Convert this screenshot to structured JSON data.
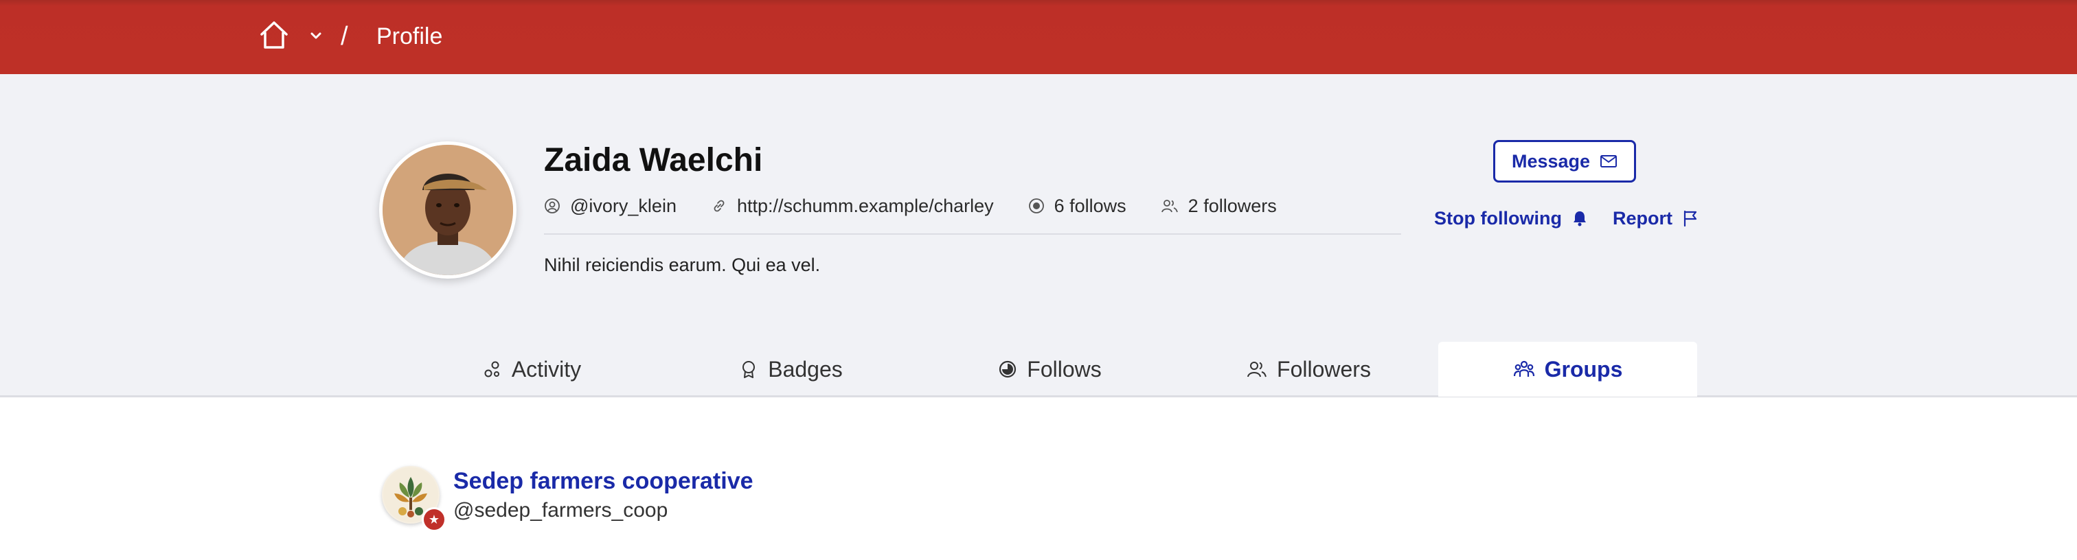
{
  "colors": {
    "brand_red": "#be3027",
    "link_blue": "#1a2aa8",
    "header_bg": "#f1f2f6"
  },
  "topbar": {
    "home_icon": "home-icon",
    "dropdown_icon": "chevron-down-icon",
    "separator": "/",
    "breadcrumb_label": "Profile"
  },
  "profile": {
    "name": "Zaida Waelchi",
    "nickname": "@ivory_klein",
    "url": "http://schumm.example/charley",
    "follows": "6 follows",
    "followers": "2 followers",
    "bio": "Nihil reiciendis earum. Qui ea vel."
  },
  "actions": {
    "message_label": "Message",
    "unfollow_label": "Stop following",
    "report_label": "Report"
  },
  "tabs": [
    {
      "label": "Activity",
      "icon": "activity-icon",
      "active": false
    },
    {
      "label": "Badges",
      "icon": "badge-icon",
      "active": false
    },
    {
      "label": "Follows",
      "icon": "follows-icon",
      "active": false
    },
    {
      "label": "Followers",
      "icon": "followers-icon",
      "active": false
    },
    {
      "label": "Groups",
      "icon": "groups-icon",
      "active": true
    }
  ],
  "groups": [
    {
      "name": "Sedep farmers cooperative",
      "handle": "@sedep_farmers_coop"
    }
  ]
}
